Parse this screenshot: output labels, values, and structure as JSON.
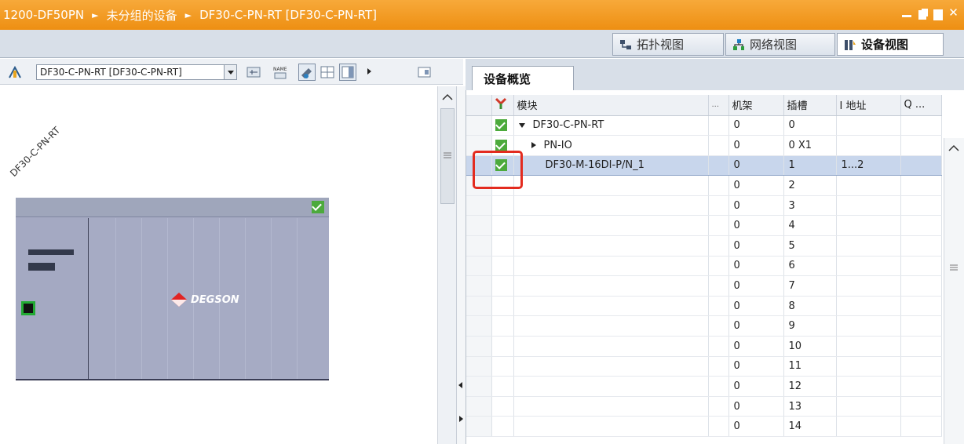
{
  "titlebar": {
    "crumbs": [
      "1200-DF50PN",
      "未分组的设备",
      "DF30-C-PN-RT [DF30-C-PN-RT]"
    ]
  },
  "view_tabs": [
    {
      "label": "拓扑视图",
      "icon": "topology-icon"
    },
    {
      "label": "网络视图",
      "icon": "network-icon"
    },
    {
      "label": "设备视图",
      "icon": "device-icon",
      "active": true
    }
  ],
  "left_toolbar": {
    "device_select_value": "DF30-C-PN-RT [DF30-C-PN-RT]"
  },
  "canvas": {
    "device_label": "DF30-C-PN-RT",
    "brand": "DEGSON"
  },
  "overview": {
    "tab_label": "设备概览",
    "columns": [
      "模块",
      "...",
      "机架",
      "插槽",
      "I 地址",
      "Q ..."
    ],
    "rows": [
      {
        "status": true,
        "expand": "down",
        "module": "DF30-C-PN-RT",
        "rack": "0",
        "slot": "0",
        "i_addr": "",
        "q_addr": ""
      },
      {
        "status": true,
        "expand": "right",
        "module": "PN-IO",
        "rack": "0",
        "slot": "0 X1",
        "i_addr": "",
        "q_addr": ""
      },
      {
        "status": true,
        "expand": "",
        "module": "DF30-M-16DI-P/N_1",
        "rack": "0",
        "slot": "1",
        "i_addr": "1...2",
        "q_addr": "",
        "selected": true
      },
      {
        "rack": "0",
        "slot": "2"
      },
      {
        "rack": "0",
        "slot": "3"
      },
      {
        "rack": "0",
        "slot": "4"
      },
      {
        "rack": "0",
        "slot": "5"
      },
      {
        "rack": "0",
        "slot": "6"
      },
      {
        "rack": "0",
        "slot": "7"
      },
      {
        "rack": "0",
        "slot": "8"
      },
      {
        "rack": "0",
        "slot": "9"
      },
      {
        "rack": "0",
        "slot": "10"
      },
      {
        "rack": "0",
        "slot": "11"
      },
      {
        "rack": "0",
        "slot": "12"
      },
      {
        "rack": "0",
        "slot": "13"
      },
      {
        "rack": "0",
        "slot": "14"
      }
    ]
  },
  "colors": {
    "title_orange": "#ee8f12",
    "status_green": "#4caa3c",
    "highlight_red": "#e32b1f",
    "rack_gray": "#a6abc4"
  }
}
